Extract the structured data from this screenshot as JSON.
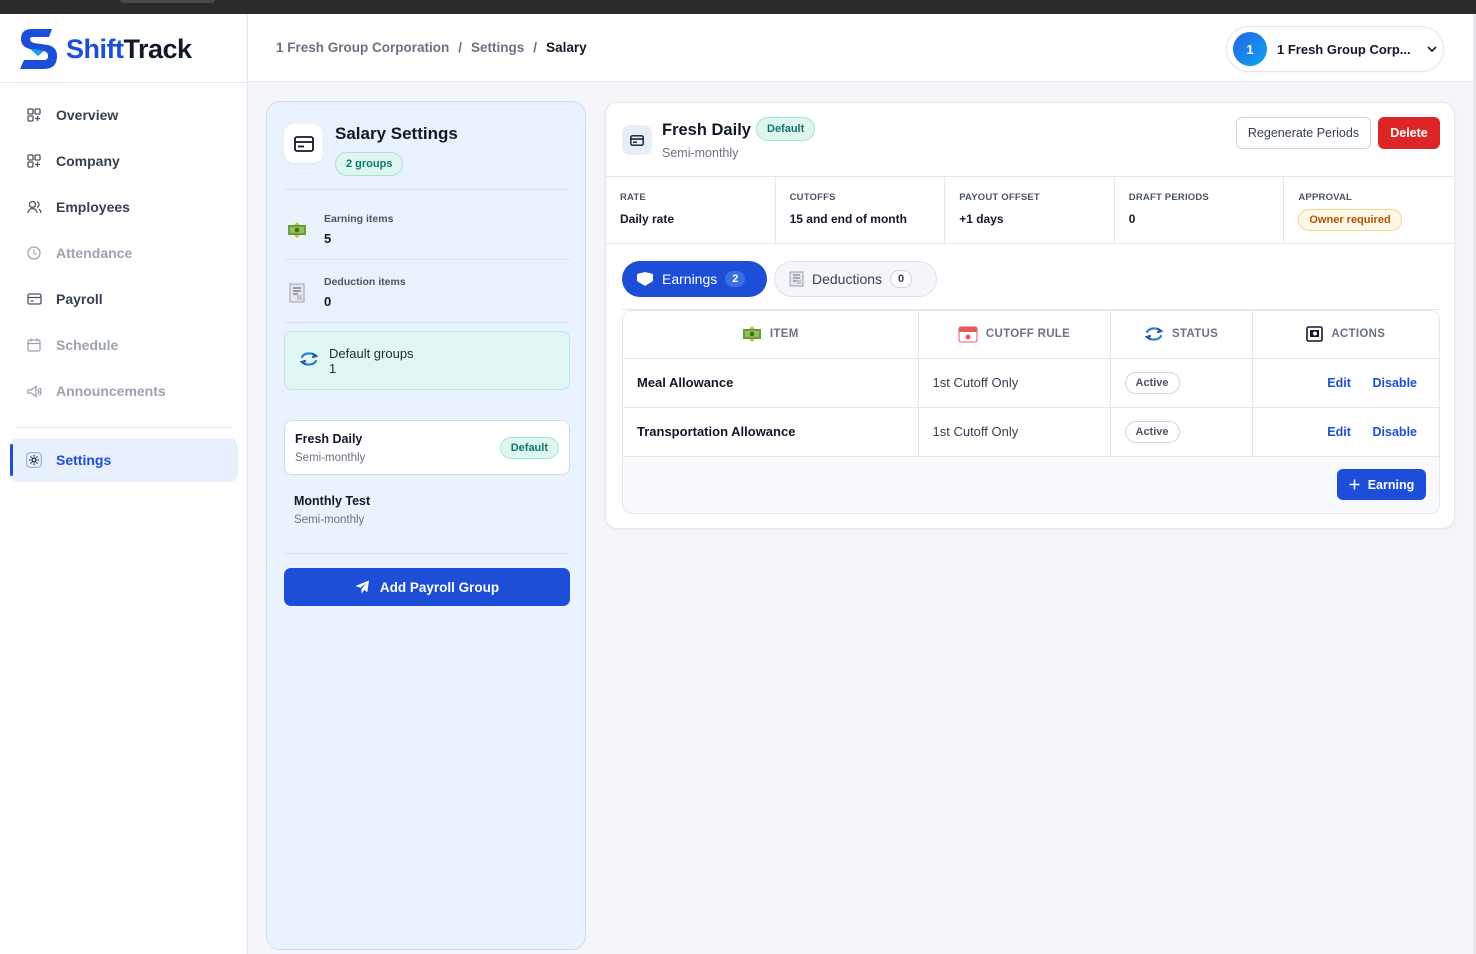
{
  "app": {
    "name_part1": "Shift",
    "name_part2": "Track"
  },
  "colors": {
    "accent": "#1d4ed8",
    "danger": "#dc2626",
    "success_bg": "#dff6ef",
    "warning": "#b45309"
  },
  "sidebar": {
    "items": [
      {
        "label": "Overview",
        "icon": "grid-icon",
        "state": "normal"
      },
      {
        "label": "Company",
        "icon": "grid-icon",
        "state": "normal"
      },
      {
        "label": "Employees",
        "icon": "users-icon",
        "state": "normal"
      },
      {
        "label": "Attendance",
        "icon": "clock-icon",
        "state": "disabled"
      },
      {
        "label": "Payroll",
        "icon": "card-icon",
        "state": "normal"
      },
      {
        "label": "Schedule",
        "icon": "calendar-icon",
        "state": "disabled"
      },
      {
        "label": "Announcements",
        "icon": "megaphone-icon",
        "state": "disabled"
      }
    ],
    "settings_label": "Settings"
  },
  "header": {
    "breadcrumb": [
      "1 Fresh Group Corporation",
      "/",
      "Settings",
      "/",
      "Salary"
    ],
    "org_avatar": "1",
    "org_name": "1 Fresh Group Corp..."
  },
  "left_panel": {
    "title": "Salary Settings",
    "groups_pill": "2 groups",
    "stats": [
      {
        "label": "Earning items",
        "value": "5"
      },
      {
        "label": "Deduction items",
        "value": "0"
      },
      {
        "label": "Default groups",
        "value": "1"
      }
    ],
    "groups": [
      {
        "name": "Fresh Daily",
        "schedule": "Semi-monthly",
        "badge": "Default"
      },
      {
        "name": "Monthly Test",
        "schedule": "Semi-monthly"
      }
    ],
    "add_button": "Add Payroll Group"
  },
  "detail": {
    "title": "Fresh Daily",
    "badge": "Default",
    "subtitle": "Semi-monthly",
    "regenerate_button": "Regenerate Periods",
    "delete_button": "Delete",
    "meta": [
      {
        "label": "RATE",
        "value": "Daily rate"
      },
      {
        "label": "CUTOFFS",
        "value": "15 and end of month"
      },
      {
        "label": "PAYOUT OFFSET",
        "value": "+1 days"
      },
      {
        "label": "DRAFT PERIODS",
        "value": "0"
      },
      {
        "label": "APPROVAL",
        "value": "Owner required"
      }
    ],
    "tabs": [
      {
        "label": "Earnings",
        "count": "2",
        "active": true
      },
      {
        "label": "Deductions",
        "count": "0",
        "active": false
      }
    ],
    "table": {
      "headers": [
        "ITEM",
        "CUTOFF RULE",
        "STATUS",
        "ACTIONS"
      ],
      "rows": [
        {
          "item": "Meal Allowance",
          "rule": "1st Cutoff Only",
          "status": "Active",
          "edit": "Edit",
          "disable": "Disable"
        },
        {
          "item": "Transportation Allowance",
          "rule": "1st Cutoff Only",
          "status": "Active",
          "edit": "Edit",
          "disable": "Disable"
        }
      ]
    },
    "add_earning_button": "Earning"
  }
}
